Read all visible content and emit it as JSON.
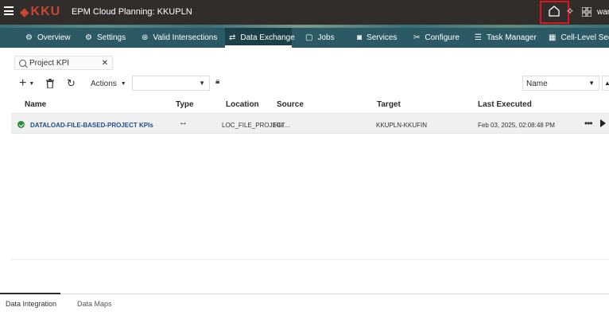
{
  "header": {
    "logo_text": "KKU",
    "app_title": "EPM Cloud Planning: KKUPLN",
    "user_label": "war"
  },
  "nav": {
    "items": [
      {
        "label": "Overview",
        "icon": "gear-icon"
      },
      {
        "label": "Settings",
        "icon": "gear-icon"
      },
      {
        "label": "Valid Intersections",
        "icon": "intersections-icon"
      },
      {
        "label": "Data Exchange",
        "icon": "exchange-icon",
        "active": true
      },
      {
        "label": "Jobs",
        "icon": "jobs-icon"
      },
      {
        "label": "Services",
        "icon": "services-icon"
      },
      {
        "label": "Configure",
        "icon": "configure-icon"
      },
      {
        "label": "Task Manager",
        "icon": "task-manager-icon"
      },
      {
        "label": "Cell-Level Secu",
        "icon": "cell-security-icon"
      }
    ]
  },
  "search": {
    "value": "Project KPI"
  },
  "toolbar": {
    "actions_label": "Actions",
    "sort_value": "Name"
  },
  "table": {
    "columns": [
      "Name",
      "Type",
      "Location",
      "Source",
      "Target",
      "Last Executed"
    ],
    "rows": [
      {
        "name": "DATALOAD-FILE-BASED-PROJECT KPIs",
        "type": "↔",
        "location": "LOC_FILE_PROJECT...",
        "source": "File",
        "target": "KKUPLN-KKUFIN",
        "last_executed": "Feb 03, 2025, 02:08:48 PM",
        "status_color": "#2e8b3d"
      }
    ]
  },
  "bottom_tabs": [
    {
      "label": "Data Integration",
      "active": true
    },
    {
      "label": "Data Maps",
      "active": false
    }
  ],
  "colors": {
    "header_bg": "#312d2a",
    "nav_bg": "#2b5a64",
    "link": "#1e4f8a",
    "highlight_box": "#e0141e"
  }
}
